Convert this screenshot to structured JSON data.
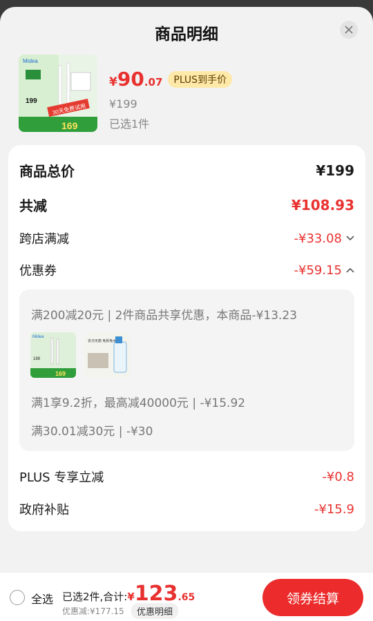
{
  "sheet": {
    "title": "商品明细"
  },
  "product": {
    "price_symbol": "¥",
    "price_int": "90",
    "price_dec": ".07",
    "plus_tag": "PLUS到手价",
    "original_price": "¥199",
    "selected": "已选1件",
    "thumb_image_text": {
      "brand": "Midea",
      "price": "199",
      "deal_price": "169",
      "banner": "30天免费试用"
    }
  },
  "breakdown": {
    "total_label": "商品总价",
    "total_value": "¥199",
    "reduce_label": "共减",
    "reduce_value": "¥108.93",
    "cross_store_label": "跨店满减",
    "cross_store_value": "-¥33.08",
    "coupon_label": "优惠券",
    "coupon_value": "-¥59.15",
    "plus_label": "PLUS 专享立减",
    "plus_value": "-¥0.8",
    "gov_label": "政府补贴",
    "gov_value": "-¥15.9"
  },
  "coupons": {
    "line1": "满200减20元 | 2件商品共享优惠，本商品-¥13.23",
    "line2": "满1享9.2折，最高减40000元 | -¥15.92",
    "line3": "满30.01减30元 | -¥30",
    "img1_text": {
      "brand": "Midea",
      "price": "199",
      "deal_price": "169"
    },
    "img2_text": {
      "headline": "去污无痕 免拆免水洗"
    }
  },
  "bottom": {
    "select_all": "全选",
    "summary_text": "已选2件,合计:",
    "total_symbol": "¥",
    "total_int": "123",
    "total_dec": ".65",
    "saved": "优惠减:¥177.15",
    "detail_link": "优惠明细",
    "checkout": "领券结算"
  },
  "colors": {
    "accent": "#e8312f",
    "button": "#ec2c2c",
    "plus_tag_bg": "#ffe9a8",
    "card_bg": "#ffffff",
    "sheet_bg": "#f2f2f2"
  }
}
